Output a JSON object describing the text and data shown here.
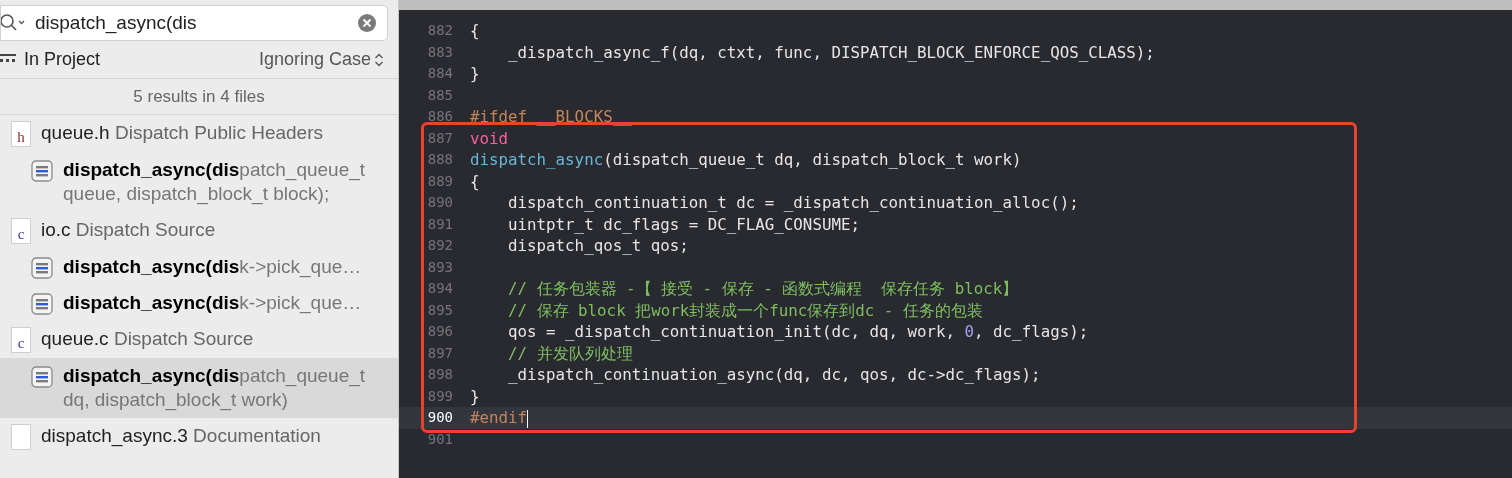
{
  "search": {
    "value": "dispatch_async(dis"
  },
  "scope": {
    "label": "In Project",
    "case_option": "Ignoring Case"
  },
  "summary": "5 results in 4 files",
  "results": [
    {
      "icon_letter": "h",
      "name": "queue.h",
      "group": "Dispatch Public Headers",
      "matches": [
        {
          "text": "**dispatch_async(dis**patch_queue_t queue, dispatch_block_t block);",
          "selected": false
        }
      ]
    },
    {
      "icon_letter": "c",
      "name": "io.c",
      "group": "Dispatch Source",
      "matches": [
        {
          "text": "**dispatch_async(dis**k->pick_que…",
          "selected": false
        },
        {
          "text": "**dispatch_async(dis**k->pick_que…",
          "selected": false
        }
      ]
    },
    {
      "icon_letter": "c",
      "name": "queue.c",
      "group": "Dispatch Source",
      "matches": [
        {
          "text": "**dispatch_async(dis**patch_queue_t dq, dispatch_block_t work)",
          "selected": true
        }
      ]
    },
    {
      "name": "dispatch_async.3",
      "group": "Documentation"
    }
  ],
  "code_lines": [
    {
      "number": "882",
      "current": false,
      "segments": [
        {
          "text": "{",
          "kind": "plain"
        }
      ]
    },
    {
      "number": "883",
      "current": false,
      "segments": [
        {
          "text": "    _dispatch_async_f(dq, ctxt, func, DISPATCH_BLOCK_ENFORCE_QOS_CLASS);",
          "kind": "plain"
        }
      ]
    },
    {
      "number": "884",
      "current": false,
      "segments": [
        {
          "text": "}",
          "kind": "plain"
        }
      ]
    },
    {
      "number": "885",
      "current": false
    },
    {
      "number": "886",
      "current": false,
      "segments": [
        {
          "text": "#ifdef __BLOCKS__",
          "kind": "preprocessor"
        }
      ]
    },
    {
      "number": "887",
      "current": false,
      "segments": [
        {
          "text": "void",
          "kind": "keyword"
        }
      ]
    },
    {
      "number": "888",
      "current": false,
      "segments": [
        {
          "text": "dispatch_async",
          "kind": "function"
        },
        {
          "text": "(dispatch_queue_t dq, dispatch_block_t work)",
          "kind": "plain"
        }
      ]
    },
    {
      "number": "889",
      "current": false,
      "segments": [
        {
          "text": "{",
          "kind": "plain"
        }
      ]
    },
    {
      "number": "890",
      "current": false,
      "segments": [
        {
          "text": "    dispatch_continuation_t dc = _dispatch_continuation_alloc();",
          "kind": "plain"
        }
      ]
    },
    {
      "number": "891",
      "current": false,
      "segments": [
        {
          "text": "    uintptr_t dc_flags = DC_FLAG_CONSUME;",
          "kind": "plain"
        }
      ]
    },
    {
      "number": "892",
      "current": false,
      "segments": [
        {
          "text": "    dispatch_qos_t qos;",
          "kind": "plain"
        }
      ]
    },
    {
      "number": "893",
      "current": false
    },
    {
      "number": "894",
      "current": false,
      "segments": [
        {
          "text": "    // 任务包装器 -【 接受 - 保存 - 函数式编程  保存任务 block】",
          "kind": "comment"
        }
      ]
    },
    {
      "number": "895",
      "current": false,
      "segments": [
        {
          "text": "    // 保存 block 把work封装成一个func保存到dc - 任务的包装",
          "kind": "comment"
        }
      ]
    },
    {
      "number": "896",
      "current": false,
      "segments": [
        {
          "text": "    qos = _dispatch_continuation_init(dc, dq, work, ",
          "kind": "plain"
        },
        {
          "text": "0",
          "kind": "number"
        },
        {
          "text": ", dc_flags);",
          "kind": "plain"
        }
      ]
    },
    {
      "number": "897",
      "current": false,
      "segments": [
        {
          "text": "    // 并发队列处理",
          "kind": "comment"
        }
      ]
    },
    {
      "number": "898",
      "current": false,
      "segments": [
        {
          "text": "    _dispatch_continuation_async(dq, dc, qos, dc->dc_flags);",
          "kind": "plain"
        }
      ]
    },
    {
      "number": "899",
      "current": false,
      "segments": [
        {
          "text": "}",
          "kind": "plain"
        }
      ]
    },
    {
      "number": "900",
      "current": true,
      "segments": [
        {
          "text": "#endif",
          "kind": "preprocessor"
        }
      ]
    },
    {
      "number": "901",
      "current": false
    }
  ]
}
